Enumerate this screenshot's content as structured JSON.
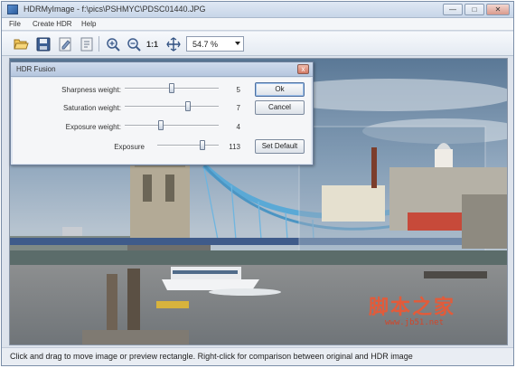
{
  "window": {
    "title": "HDRMyImage - f:\\pics\\PSHMYC\\PDSC01440.JPG",
    "minimize_glyph": "—",
    "maximize_glyph": "□",
    "close_glyph": "✕"
  },
  "menu": {
    "file": "File",
    "create_hdr": "Create HDR",
    "help": "Help"
  },
  "toolbar": {
    "icons": [
      "open-folder-icon",
      "save-icon",
      "edit-icon",
      "export-icon",
      "zoom-in-icon",
      "zoom-out-icon",
      "actual-size-icon",
      "fit-to-window-icon"
    ],
    "actual_size_label": "1:1",
    "zoom_value": "54.7 %"
  },
  "dialog": {
    "title": "HDR Fusion",
    "close_glyph": "x",
    "rows": [
      {
        "label": "Sharpness weight:",
        "value": "5",
        "level": 0.5
      },
      {
        "label": "Saturation weight:",
        "value": "7",
        "level": 0.68
      },
      {
        "label": "Exposure weight:",
        "value": "4",
        "level": 0.38
      },
      {
        "label": "Exposure",
        "value": "113",
        "level": 0.75
      }
    ],
    "ok_label": "Ok",
    "cancel_label": "Cancel",
    "set_default_label": "Set Default"
  },
  "status": {
    "text": "Click and drag to move image or preview rectangle. Right-click for comparison between original and HDR image"
  },
  "watermark": {
    "chinese": "脚本之家",
    "url": "www.jb51.net"
  },
  "colors": {
    "accent": "#3a6db5",
    "title_bar": "#c7d5e8",
    "watermark": "#e25b3a"
  }
}
